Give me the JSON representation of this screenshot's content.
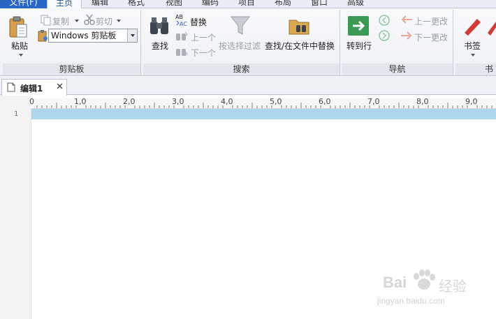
{
  "menu": {
    "tabs": [
      {
        "label": "文件(F)"
      },
      {
        "label": "主页"
      },
      {
        "label": "编辑"
      },
      {
        "label": "格式"
      },
      {
        "label": "视图"
      },
      {
        "label": "编码"
      },
      {
        "label": "项目"
      },
      {
        "label": "布局"
      },
      {
        "label": "窗口"
      },
      {
        "label": "高级"
      }
    ]
  },
  "ribbon": {
    "clipboard": {
      "title": "剪贴板",
      "paste": "粘贴",
      "copy": "复制",
      "cut": "剪切",
      "clipboard_select": "Windows 剪贴板"
    },
    "search": {
      "title": "搜索",
      "find": "查找",
      "replace": "替换",
      "find_prev": "上一个",
      "find_next": "下一个",
      "filter": "按选择过滤",
      "find_in_files": "查找/在文件中替换"
    },
    "navigation": {
      "title": "导航",
      "goto_line": "转到行",
      "prev_change": "上一更改",
      "next_change": "下一更改"
    },
    "bookmarks": {
      "title": "书签",
      "bookmark": "书签"
    }
  },
  "documents": {
    "active_tab": "编辑1",
    "close_glyph": "✕"
  },
  "editor": {
    "ruler_labels": [
      "0",
      "1,0",
      "2,0",
      "3,0",
      "4,0",
      "5,0",
      "6,0",
      "7,0",
      "8,0",
      "9,0"
    ],
    "line_numbers": [
      "1"
    ]
  },
  "watermark": {
    "logo": "Bai",
    "brand": "经验",
    "url": "jingyan.baidu.com"
  },
  "colors": {
    "file_tab": "#2a66c5",
    "current_line": "#abd6ee",
    "goto_green": "#3a9a55",
    "bookmark_red": "#d23b33"
  }
}
